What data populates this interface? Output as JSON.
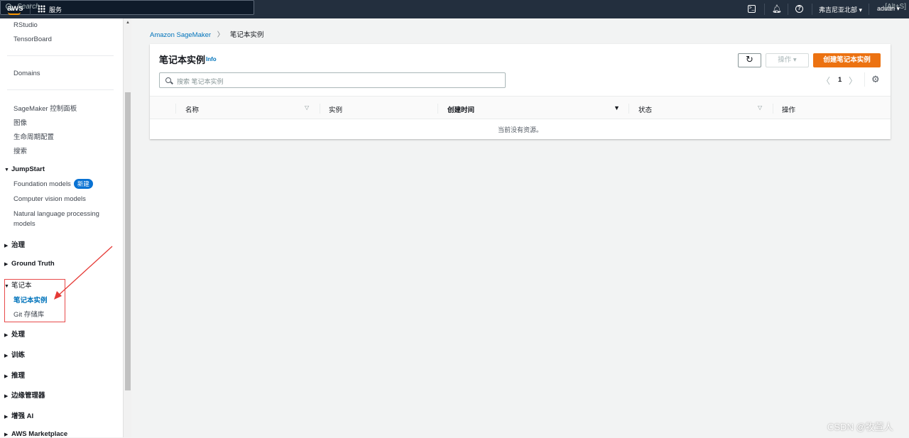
{
  "topbar": {
    "logo": "aws",
    "services": "服务",
    "search_placeholder": "Search",
    "search_shortcut": "[Alt+S]",
    "region": "弗吉尼亚北部",
    "user": "aduan"
  },
  "sidebar": {
    "items_top": [
      "RStudio",
      "TensorBoard",
      "Domains",
      "SageMaker 控制面板",
      "图像",
      "生命周期配置",
      "搜索"
    ],
    "jumpstart": {
      "label": "JumpStart",
      "items": [
        "Foundation models",
        "Computer vision models",
        "Natural language processing models"
      ],
      "badge": "新建"
    },
    "governance": "治理",
    "ground_truth": "Ground Truth",
    "notebook": {
      "label": "笔记本",
      "items": [
        "笔记本实例",
        "Git 存储库"
      ]
    },
    "sections": [
      "处理",
      "训练",
      "推理",
      "边缘管理器",
      "增强 AI",
      "AWS Marketplace"
    ]
  },
  "breadcrumb": [
    "Amazon SageMaker",
    "笔记本实例"
  ],
  "panel": {
    "title": "笔记本实例",
    "info": "Info",
    "search_placeholder": "搜索 笔记本实例",
    "actions_label": "操作",
    "create_label": "创建笔记本实例",
    "page": "1",
    "columns": [
      "名称",
      "实例",
      "创建时间",
      "状态",
      "操作"
    ],
    "empty": "当前没有资源。"
  },
  "watermark": "CSDN @牧萱人",
  "colors": {
    "accent": "#ec7211",
    "link": "#0073bb",
    "topbar": "#232f3e"
  }
}
